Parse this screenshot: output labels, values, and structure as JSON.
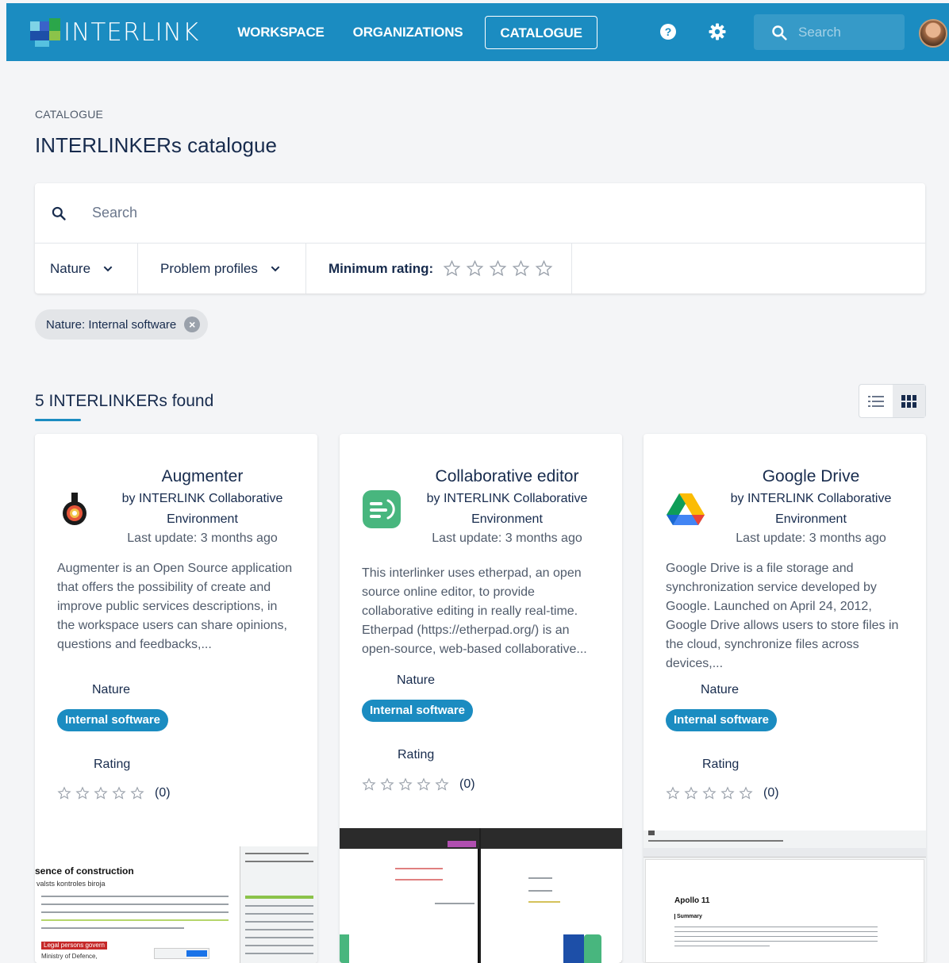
{
  "header": {
    "logo_text": "INTERLINK",
    "nav": [
      "WORKSPACE",
      "ORGANIZATIONS",
      "CATALOGUE"
    ],
    "active_nav": "CATALOGUE",
    "search_placeholder": "Search",
    "icons": [
      "help-icon",
      "settings-icon",
      "search-icon"
    ],
    "colors": {
      "bar": "#1b8cc1"
    }
  },
  "page": {
    "breadcrumb": "CATALOGUE",
    "title": "INTERLINKERs catalogue"
  },
  "filters": {
    "search_placeholder": "Search",
    "nature_label": "Nature",
    "problem_profiles_label": "Problem profiles",
    "min_rating_label": "Minimum rating:",
    "min_rating_value": 0,
    "min_rating_max": 5
  },
  "active_chip": "Nature: Internal software",
  "results": {
    "count_label": "5 INTERLINKERs found",
    "view_mode": "grid"
  },
  "cards": [
    {
      "title": "Augmenter",
      "author": "by INTERLINK Collaborative Environment",
      "updated": "Last update: 3 months ago",
      "description": "Augmenter is an Open Source application that offers the possibility of create and improve public services descriptions, in the workspace users can share opinions, questions and feedbacks,...",
      "nature_label": "Nature",
      "nature_value": "Internal software",
      "rating_label": "Rating",
      "rating_value": 0,
      "rating_count": "(0)",
      "snapshot": {
        "heading": "sence of construction",
        "subheading": "valsts kontroles biroja",
        "highlight": "Legal persons govern",
        "footer": "Ministry of Defence,"
      }
    },
    {
      "title": "Collaborative editor",
      "author": "by INTERLINK Collaborative Environment",
      "updated": "Last update: 3 months ago",
      "description": "This interlinker uses etherpad, an open source online editor, to provide collaborative editing in really real-time. Etherpad (https://etherpad.org/) is an open-source, web-based collaborative...",
      "nature_label": "Nature",
      "nature_value": "Internal software",
      "rating_label": "Rating",
      "rating_value": 0,
      "rating_count": "(0)"
    },
    {
      "title": "Google Drive",
      "author": "by INTERLINK Collaborative Environment",
      "updated": "Last update: 3 months ago",
      "description": "Google Drive is a file storage and synchronization service developed by Google. Launched on April 24, 2012, Google Drive allows users to store files in the cloud, synchronize files across devices,...",
      "nature_label": "Nature",
      "nature_value": "Internal software",
      "rating_label": "Rating",
      "rating_value": 0,
      "rating_count": "(0)",
      "snapshot": {
        "heading": "Apollo 11",
        "subheading": "Summary"
      }
    }
  ]
}
